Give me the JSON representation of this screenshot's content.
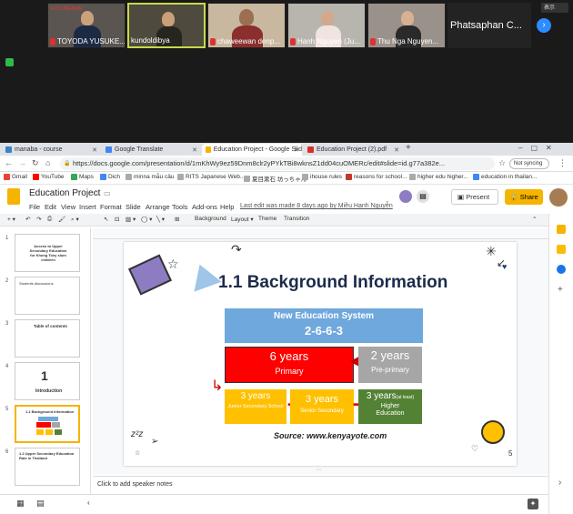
{
  "zoom": {
    "participants": [
      {
        "name": "TOYODA YUSUKE..."
      },
      {
        "name": "kundoldibya"
      },
      {
        "name": "chaweewan denp..."
      },
      {
        "name": "Hanh Nguyen (Ju..."
      },
      {
        "name": "Thu Nga Nguyen..."
      },
      {
        "name": "Phatsaphan C..."
      }
    ],
    "display_label": "表示",
    "tile_logo_text": "RITSUMEIKAN"
  },
  "browser": {
    "tabs": [
      {
        "label": "manaba - course"
      },
      {
        "label": "Google Translate"
      },
      {
        "label": "Education Project - Google Slid"
      },
      {
        "label": "Education Project (2).pdf"
      }
    ],
    "new_tab": "+",
    "url": "https://docs.google.com/presentation/d/1mKhWy9ez59Dnm8clr2yPYkTBi8wknsZ1dd04cuOMERc/edit#slide=id.g77a382e...",
    "not_syncing": "Not syncing",
    "bookmarks": [
      "Gmail",
      "YouTube",
      "Maps",
      "Dich",
      "minna mẫu câu",
      "RITS Japanese Web...",
      "夏目漱石 坊っちゃん",
      "ihouse rules",
      "reasons for school...",
      "higher edu higher...",
      "education in thailan..."
    ],
    "colors": {
      "accent": "#f4b400",
      "blue": "#1a73e8"
    }
  },
  "slides_app": {
    "title": "Education Project",
    "menus": [
      "File",
      "Edit",
      "View",
      "Insert",
      "Format",
      "Slide",
      "Arrange",
      "Tools",
      "Add-ons",
      "Help"
    ],
    "last_edit": "Last edit was made 8 days ago by Miều Hạnh Nguyễn",
    "present_label": "Present",
    "share_label": "Share",
    "toolbar": {
      "background": "Background",
      "layout": "Layout",
      "theme": "Theme",
      "transition": "Transition"
    },
    "notes_placeholder": "Click to add speaker notes",
    "thumbnails": [
      {
        "num": "1",
        "caption": "Access to Upper Secondary Education for Khong Toey slum children"
      },
      {
        "num": "2",
        "caption": "Students discussions"
      },
      {
        "num": "3",
        "caption": "Table of contents"
      },
      {
        "num": "4",
        "caption": "Introduction"
      },
      {
        "num": "5",
        "caption": "1.1 Background Information"
      },
      {
        "num": "6",
        "caption": "1.2 Upper Secondary Education Rate in Thailand"
      }
    ],
    "selected_slide": 5
  },
  "slide": {
    "title": "1.1 Background Information",
    "system_title": "New Education System",
    "system_code": "2-6-6-3",
    "primary_years": "6 years",
    "primary_label": "Primary",
    "preprimary_years": "2 years",
    "preprimary_label": "Pre-primary",
    "junior_years": "3 years",
    "junior_label": "Junior Secondary School",
    "senior_years": "3 years",
    "senior_label": "Senior Secondary",
    "higher_years": "3 years",
    "higher_atleast": "(at least)",
    "higher_label": "Higher Education",
    "source": "Source: www.kenyayote.com",
    "page_number": "5",
    "colors": {
      "blue": "#6fa8dc",
      "red": "#ff0000",
      "gray": "#a6a6a6",
      "orange": "#ffc000",
      "green": "#548235"
    }
  }
}
